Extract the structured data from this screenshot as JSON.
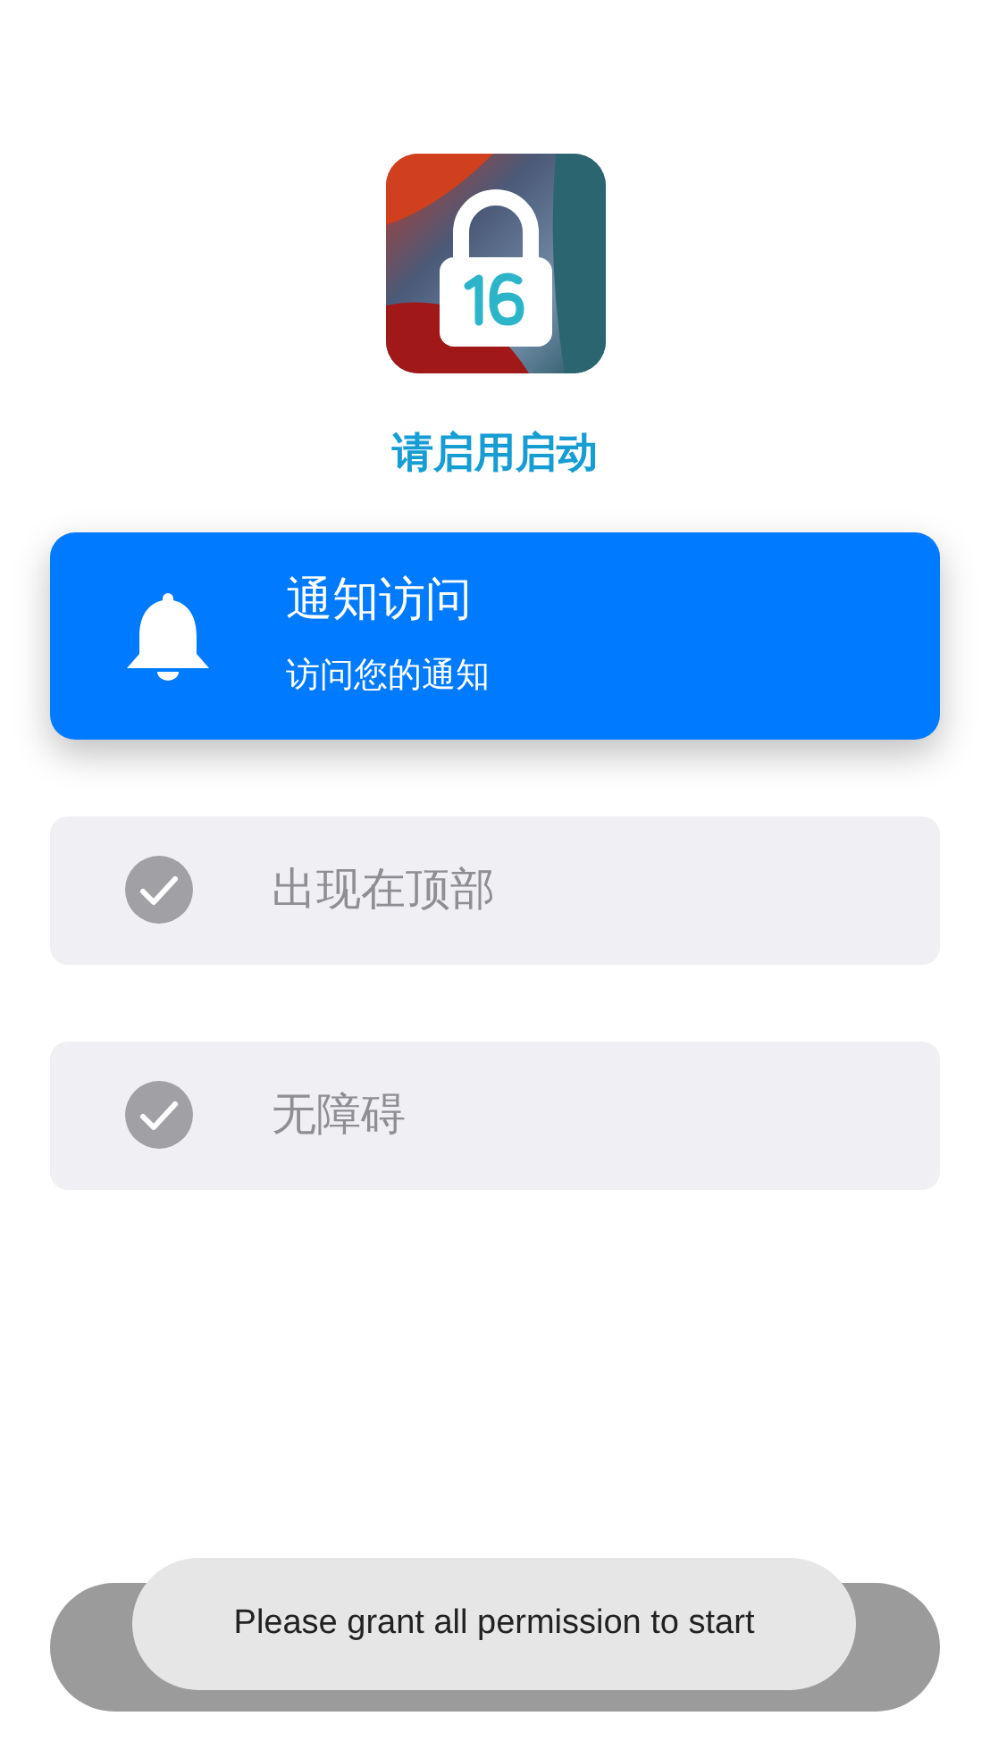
{
  "header": {
    "title": "请启用启动"
  },
  "permissions": [
    {
      "title": "通知访问",
      "subtitle": "访问您的通知",
      "active": true
    },
    {
      "title": "出现在顶部",
      "active": false
    },
    {
      "title": "无障碍",
      "active": false
    }
  ],
  "toast": {
    "text": "Please grant all permission to start"
  }
}
